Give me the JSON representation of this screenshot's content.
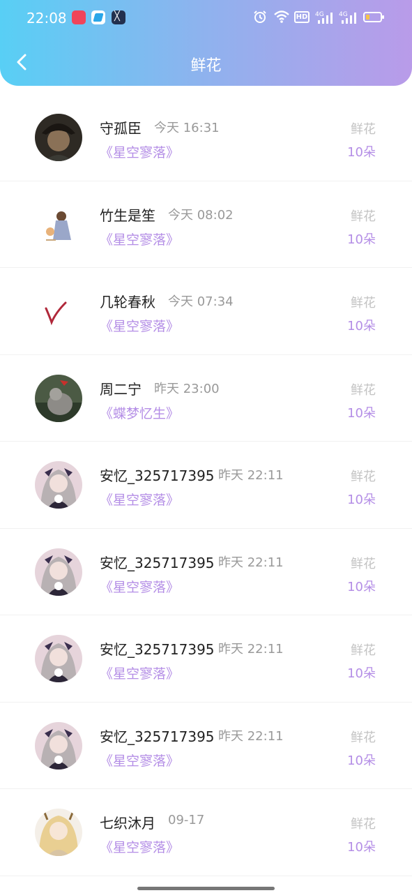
{
  "status_bar": {
    "time": "22:08",
    "app_icons": [
      "red-app-icon",
      "telegram-like-icon",
      "dark-app-icon"
    ],
    "indicators": [
      "alarm-icon",
      "wifi-icon",
      "hd-icon",
      "4g-signal-icon",
      "4g-signal-icon",
      "battery-icon"
    ],
    "hd_label": "HD",
    "net_label": "4G"
  },
  "header": {
    "title": "鲜花",
    "back_icon": "chevron-left-icon"
  },
  "colors": {
    "accent": "#b48ee6",
    "gradient_start": "#58cff5",
    "gradient_end": "#b99be9"
  },
  "rows": [
    {
      "name": "守孤臣",
      "time": "今天 16:31",
      "book": "《星空寥落》",
      "gift_label": "鲜花",
      "count": "10朵"
    },
    {
      "name": "竹生是笙",
      "time": "今天 08:02",
      "book": "《星空寥落》",
      "gift_label": "鲜花",
      "count": "10朵"
    },
    {
      "name": "几轮春秋",
      "time": "今天 07:34",
      "book": "《星空寥落》",
      "gift_label": "鲜花",
      "count": "10朵"
    },
    {
      "name": "周二宁",
      "time": "昨天 23:00",
      "book": "《蝶梦忆生》",
      "gift_label": "鲜花",
      "count": "10朵"
    },
    {
      "name": "安忆_325717395",
      "time": "昨天 22:11",
      "book": "《星空寥落》",
      "gift_label": "鲜花",
      "count": "10朵"
    },
    {
      "name": "安忆_325717395",
      "time": "昨天 22:11",
      "book": "《星空寥落》",
      "gift_label": "鲜花",
      "count": "10朵"
    },
    {
      "name": "安忆_325717395",
      "time": "昨天 22:11",
      "book": "《星空寥落》",
      "gift_label": "鲜花",
      "count": "10朵"
    },
    {
      "name": "安忆_325717395",
      "time": "昨天 22:11",
      "book": "《星空寥落》",
      "gift_label": "鲜花",
      "count": "10朵"
    },
    {
      "name": "七织沐月",
      "time": "09-17",
      "book": "《星空寥落》",
      "gift_label": "鲜花",
      "count": "10朵"
    }
  ]
}
